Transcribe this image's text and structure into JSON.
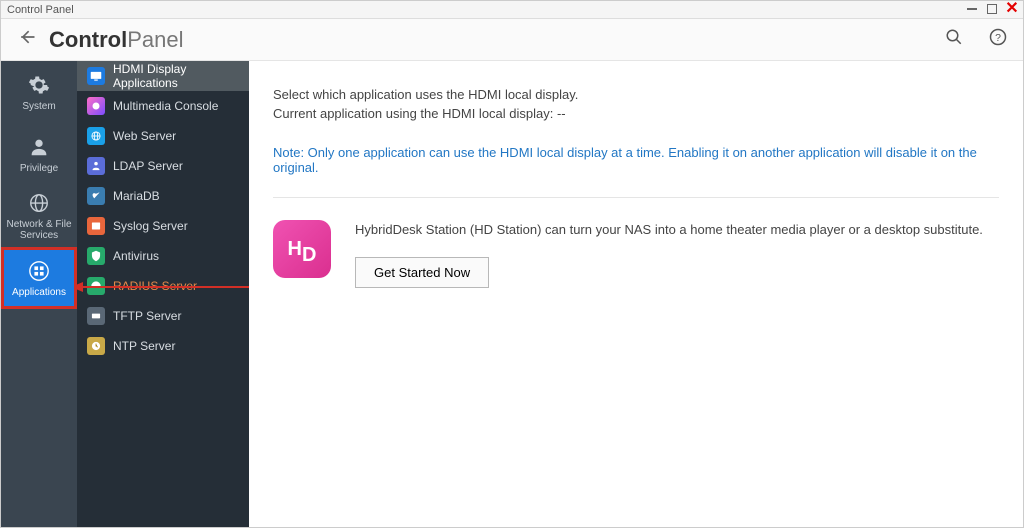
{
  "window": {
    "title": "Control Panel"
  },
  "header": {
    "title_a": "Control",
    "title_b": "Panel"
  },
  "nav": {
    "items": [
      {
        "label": "System"
      },
      {
        "label": "Privilege"
      },
      {
        "label": "Network & File Services"
      },
      {
        "label": "Applications"
      }
    ]
  },
  "subnav": [
    {
      "label": "HDMI Display Applications",
      "selected": true
    },
    {
      "label": "Multimedia Console"
    },
    {
      "label": "Web Server"
    },
    {
      "label": "LDAP Server"
    },
    {
      "label": "MariaDB"
    },
    {
      "label": "Syslog Server"
    },
    {
      "label": "Antivirus"
    },
    {
      "label": "RADIUS Server"
    },
    {
      "label": "TFTP Server"
    },
    {
      "label": "NTP Server"
    }
  ],
  "content": {
    "p1": "Select which application uses the HDMI local display.",
    "p2": "Current application using the HDMI local display: --",
    "note": "Note: Only one application can use the HDMI local display at a time. Enabling it on another application will disable it on the original.",
    "card_desc": "HybridDesk Station (HD Station) can turn your NAS into a home theater media player or a desktop substitute.",
    "cta": "Get Started Now"
  }
}
